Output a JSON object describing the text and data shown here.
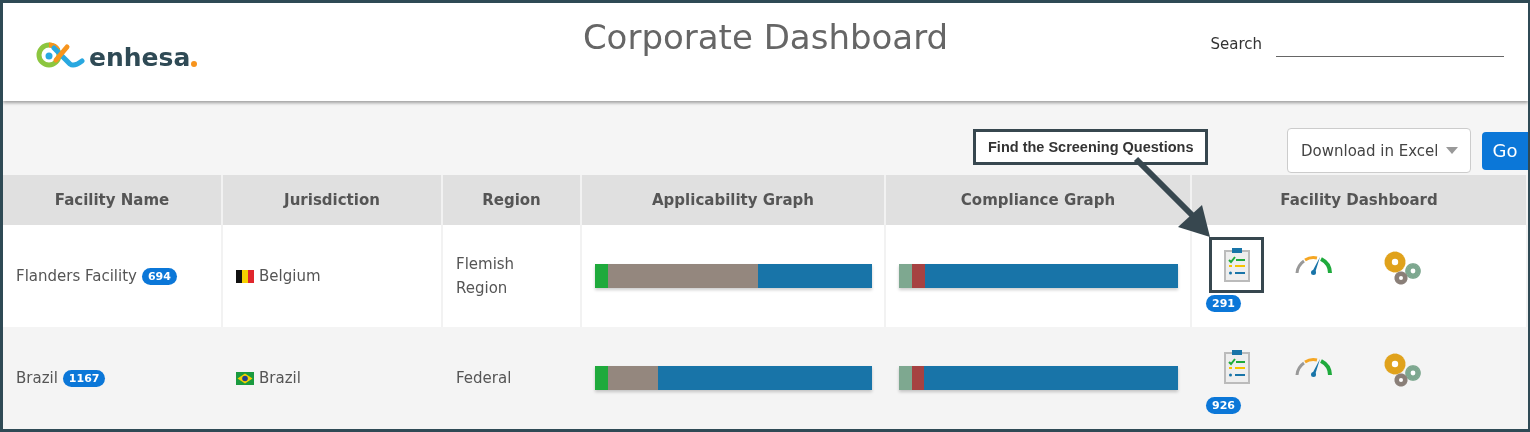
{
  "header": {
    "logo_text": "enhesa",
    "title": "Corporate Dashboard",
    "search": {
      "label": "Search"
    }
  },
  "toolbar": {
    "export_select": {
      "value": "Download in Excel"
    },
    "go_button": "Go"
  },
  "callout": {
    "text": "Find the Screening Questions"
  },
  "table": {
    "columns": [
      "Facility Name",
      "Jurisdiction",
      "Region",
      "Applicability Graph",
      "Compliance Graph",
      "Facility Dashboard"
    ],
    "rows": [
      {
        "facility": "Flanders Facility",
        "facility_count": "694",
        "flag": {
          "kind": "belgium"
        },
        "jurisdiction": "Belgium",
        "region": "Flemish Region",
        "applicability": {
          "color": "#1874a8",
          "segments": [
            {
              "color": "#1faa3c",
              "level": 0.047
            },
            {
              "color": "#94877e",
              "level": 0.59
            }
          ]
        },
        "compliance": {
          "color": "#1874a8",
          "segments": [
            {
              "color": "#7ea890",
              "level": 0.047
            },
            {
              "color": "#a64242",
              "level": 0.094
            }
          ]
        },
        "questions_count": "291",
        "highlighted": true
      },
      {
        "facility": "Brazil",
        "facility_count": "1167",
        "flag": {
          "kind": "brazil"
        },
        "jurisdiction": "Brazil",
        "region": "Federal",
        "applicability": {
          "color": "#1874a8",
          "segments": [
            {
              "color": "#1faa3c",
              "level": 0.047
            },
            {
              "color": "#94877e",
              "level": 0.227
            }
          ]
        },
        "compliance": {
          "color": "#1874a8",
          "segments": [
            {
              "color": "#7ea890",
              "level": 0.047
            },
            {
              "color": "#a64242",
              "level": 0.09
            }
          ]
        },
        "questions_count": "926",
        "highlighted": false
      }
    ]
  }
}
